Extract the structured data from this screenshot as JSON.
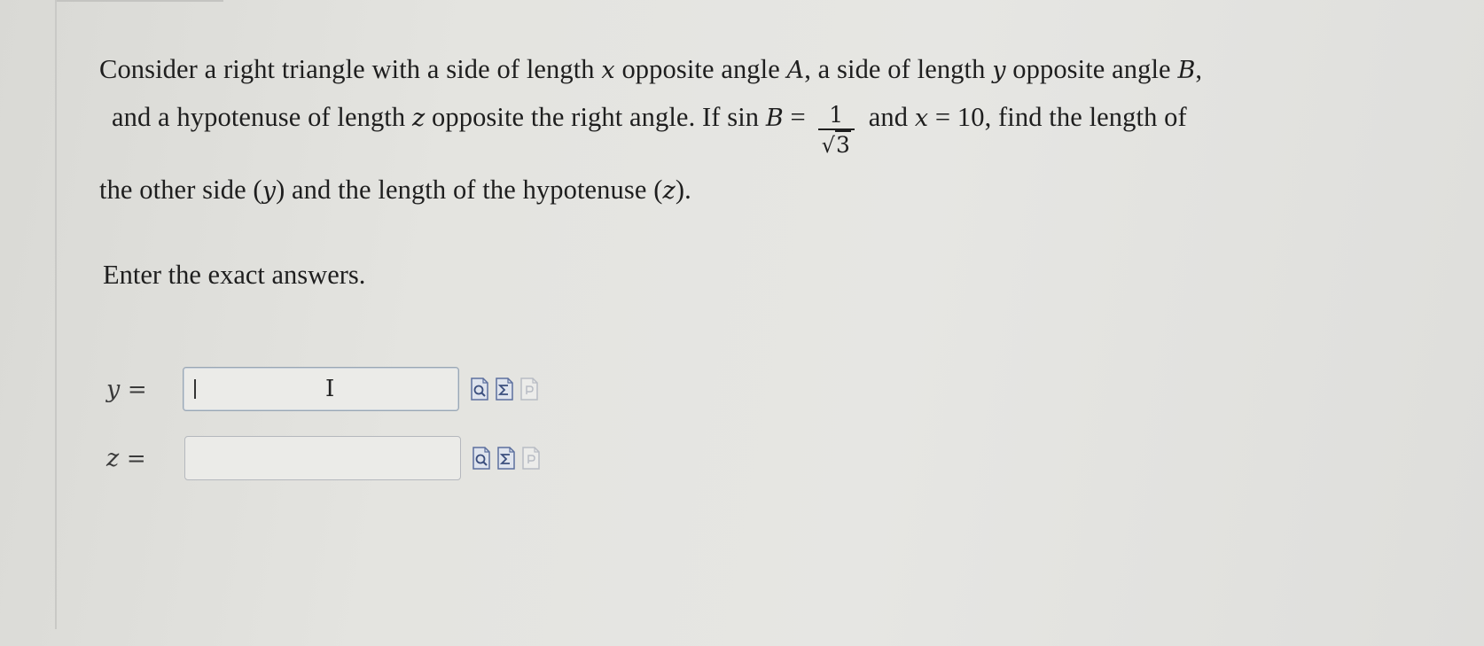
{
  "question": {
    "line1": {
      "t1": "Consider a right triangle with a side of length ",
      "v1": "x",
      "t2": " opposite angle ",
      "v2": "A",
      "t3": ", a side of length ",
      "v3": "y",
      "t4": " opposite angle ",
      "v4": "B",
      "t5": ","
    },
    "line2": {
      "t1": "and a hypotenuse of length ",
      "v1": "z",
      "t2": " opposite the right angle. If sin ",
      "v2": "B",
      "t3": " = ",
      "frac_num": "1",
      "frac_den_sym": "√",
      "frac_den_arg": "3",
      "t4": " and ",
      "v3": "x",
      "t5": " = 10, find the length of"
    },
    "line3": {
      "t1": "the other side (",
      "v1": "y",
      "t2": ") and the length of the hypotenuse (",
      "v2": "z",
      "t3": ")."
    }
  },
  "instruction": "Enter the exact answers.",
  "answers": [
    {
      "variable": "y",
      "equals": "=",
      "value": "",
      "focused": true,
      "tools": [
        "preview-icon",
        "equation-editor-icon",
        "help-document-icon"
      ]
    },
    {
      "variable": "z",
      "equals": "=",
      "value": "",
      "focused": false,
      "tools": [
        "preview-icon",
        "equation-editor-icon",
        "help-document-icon"
      ]
    }
  ],
  "ibeam_glyph": "I",
  "colors": {
    "background": "#e4e4e0",
    "text": "#1e1e1e",
    "input_border": "#b5b8bd",
    "icon_blue": "#5c6f9e"
  }
}
